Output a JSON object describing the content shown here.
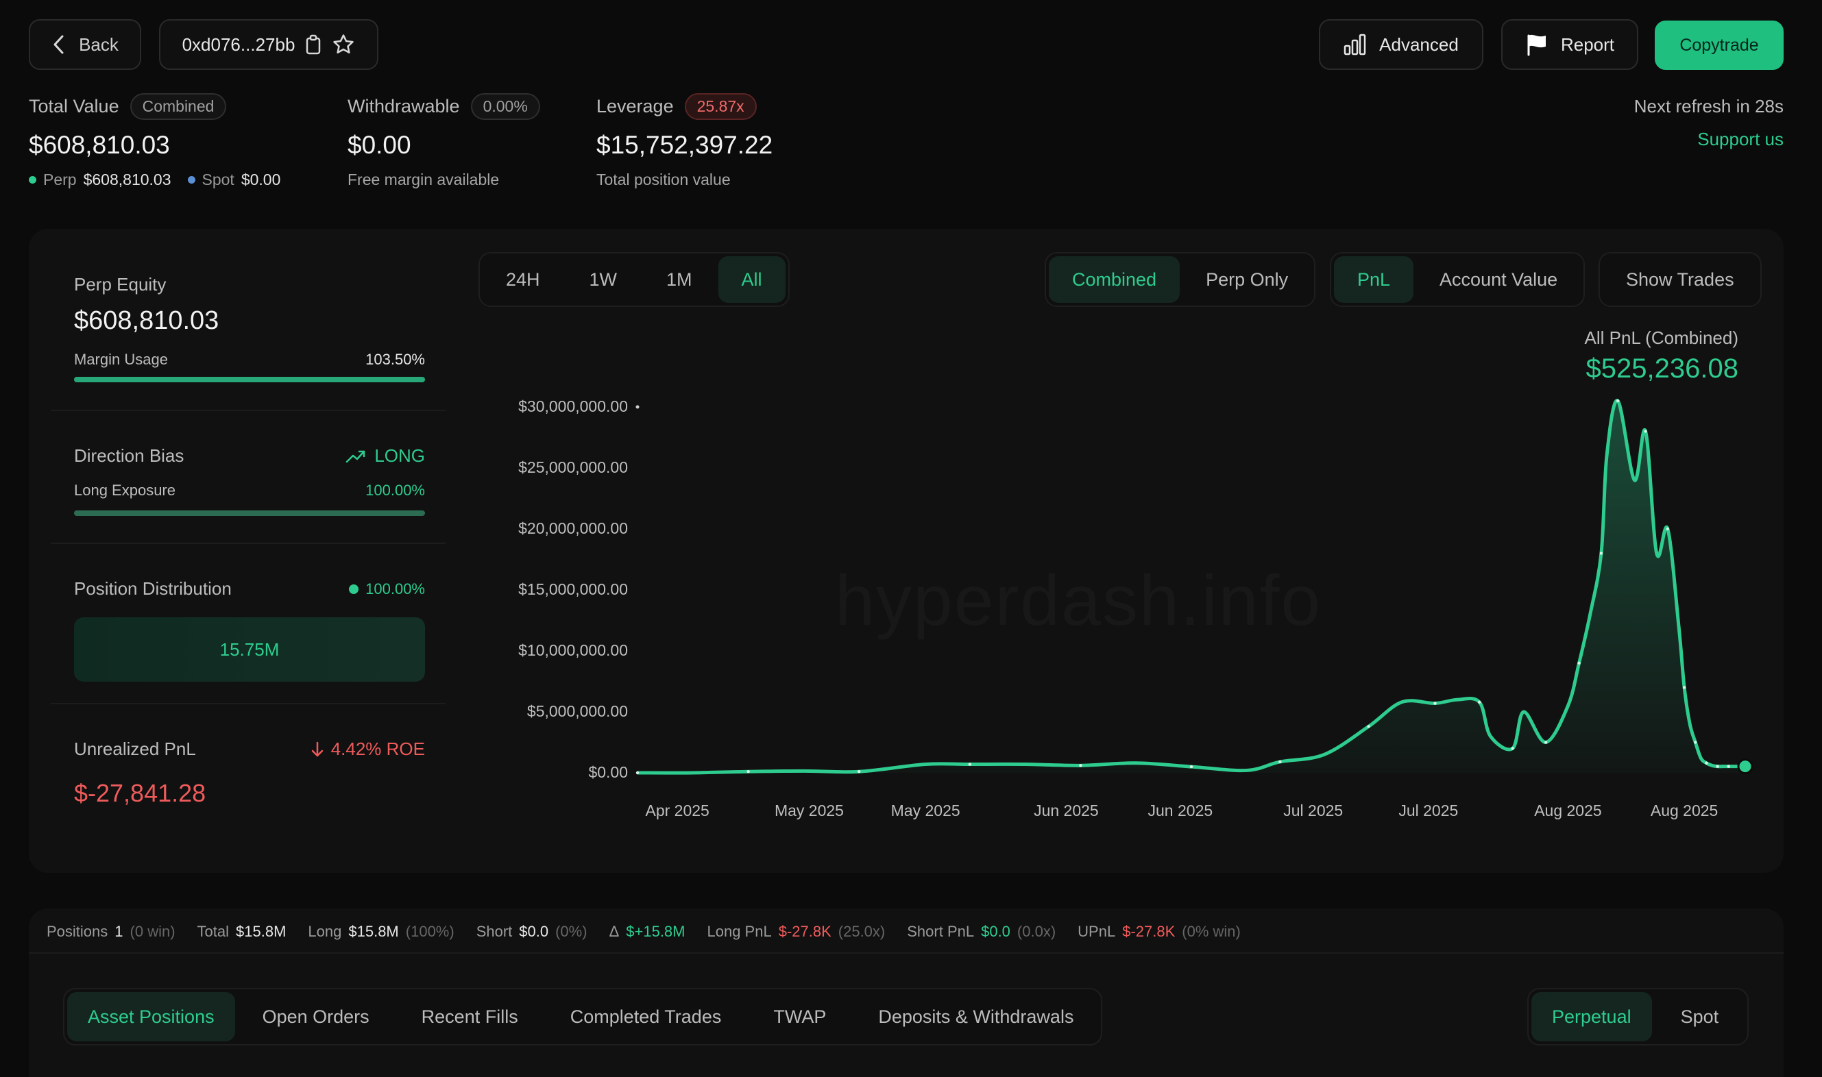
{
  "header": {
    "back_label": "Back",
    "address": "0xd076...27bb",
    "advanced_label": "Advanced",
    "report_label": "Report",
    "copytrade_label": "Copytrade"
  },
  "summary": {
    "total_value": {
      "label": "Total Value",
      "badge": "Combined",
      "value": "$608,810.03",
      "perp_label": "Perp",
      "perp_value": "$608,810.03",
      "spot_label": "Spot",
      "spot_value": "$0.00"
    },
    "withdrawable": {
      "label": "Withdrawable",
      "badge": "0.00%",
      "value": "$0.00",
      "sub": "Free margin available"
    },
    "leverage": {
      "label": "Leverage",
      "badge": "25.87x",
      "value": "$15,752,397.22",
      "sub": "Total position value"
    },
    "refresh_text": "Next refresh in 28s",
    "support_label": "Support us"
  },
  "left_card": {
    "perp_equity_label": "Perp Equity",
    "perp_equity_value": "$608,810.03",
    "margin_usage_label": "Margin Usage",
    "margin_usage_value": "103.50%",
    "margin_usage_fraction": 1.0,
    "direction_bias_label": "Direction Bias",
    "direction_bias_value": "LONG",
    "long_exposure_label": "Long Exposure",
    "long_exposure_value": "100.00%",
    "long_exposure_fraction": 1.0,
    "position_distribution_label": "Position Distribution",
    "position_distribution_value": "100.00%",
    "position_distribution_bar": "15.75M",
    "unrealized_pnl_label": "Unrealized PnL",
    "unrealized_roe": "4.42% ROE",
    "unrealized_pnl_value": "$-27,841.28"
  },
  "chart_controls": {
    "ranges": [
      "24H",
      "1W",
      "1M",
      "All"
    ],
    "active_range": "All",
    "scope": [
      "Combined",
      "Perp Only"
    ],
    "metric": [
      "PnL",
      "Account Value"
    ],
    "show_trades_label": "Show Trades"
  },
  "chart_header": {
    "label": "All PnL (Combined)",
    "value": "$525,236.08"
  },
  "watermark": "hyperdash.info",
  "chart_data": {
    "type": "area",
    "title": "",
    "y_tick_labels": [
      "$30,000,000.00",
      "$25,000,000.00",
      "$20,000,000.00",
      "$15,000,000.00",
      "$10,000,000.00",
      "$5,000,000.00",
      "$0.00"
    ],
    "x_tick_labels": [
      "Apr 2025",
      "May 2025",
      "May 2025",
      "Jun 2025",
      "Jun 2025",
      "Jul 2025",
      "Jul 2025",
      "Aug 2025",
      "Aug 2025"
    ],
    "ylim": [
      0,
      30000000
    ],
    "series": [
      {
        "x": [
          0,
          0.05,
          0.1,
          0.15,
          0.2,
          0.26,
          0.3,
          0.35,
          0.4,
          0.45,
          0.5,
          0.55,
          0.58,
          0.62,
          0.66,
          0.69,
          0.72,
          0.74,
          0.76,
          0.77,
          0.79,
          0.8,
          0.82,
          0.84,
          0.85,
          0.86,
          0.87,
          0.875,
          0.885,
          0.9,
          0.91,
          0.92,
          0.93,
          0.94,
          0.945,
          0.95,
          0.955,
          0.96,
          0.965,
          0.97,
          0.975,
          0.98,
          0.985,
          0.99,
          0.995,
          1.0
        ],
        "values": [
          0,
          0,
          100000,
          150000,
          100000,
          700000,
          700000,
          700000,
          600000,
          800000,
          500000,
          200000,
          900000,
          1500000,
          3800000,
          5800000,
          5700000,
          6000000,
          5800000,
          3000000,
          2000000,
          5000000,
          2500000,
          5500000,
          9000000,
          13000000,
          18000000,
          26000000,
          30500000,
          24000000,
          28000000,
          18000000,
          20000000,
          12000000,
          7000000,
          4000000,
          2500000,
          1200000,
          800000,
          600000,
          525236,
          525236,
          525236,
          525236,
          525236,
          525236
        ]
      }
    ],
    "grid": false,
    "color": "#2ecc8f"
  },
  "stats_bar": {
    "positions_label": "Positions",
    "positions_value": "1",
    "positions_note": "(0 win)",
    "total_label": "Total",
    "total_value": "$15.8M",
    "long_label": "Long",
    "long_value": "$15.8M",
    "long_note": "(100%)",
    "short_label": "Short",
    "short_value": "$0.0",
    "short_note": "(0%)",
    "delta_label": "Δ",
    "delta_value": "$+15.8M",
    "long_pnl_label": "Long PnL",
    "long_pnl_value": "$-27.8K",
    "long_pnl_note": "(25.0x)",
    "short_pnl_label": "Short PnL",
    "short_pnl_value": "$0.0",
    "short_pnl_note": "(0.0x)",
    "upnl_label": "UPnL",
    "upnl_value": "$-27.8K",
    "upnl_note": "(0% win)"
  },
  "bottom_tabs": [
    "Asset Positions",
    "Open Orders",
    "Recent Fills",
    "Completed Trades",
    "TWAP",
    "Deposits & Withdrawals"
  ],
  "market_tabs": [
    "Perpetual",
    "Spot"
  ],
  "colors": {
    "accent": "#2ecc8f",
    "negative": "#ef5b5b",
    "background": "#0b0b0b",
    "panel": "#111111"
  }
}
